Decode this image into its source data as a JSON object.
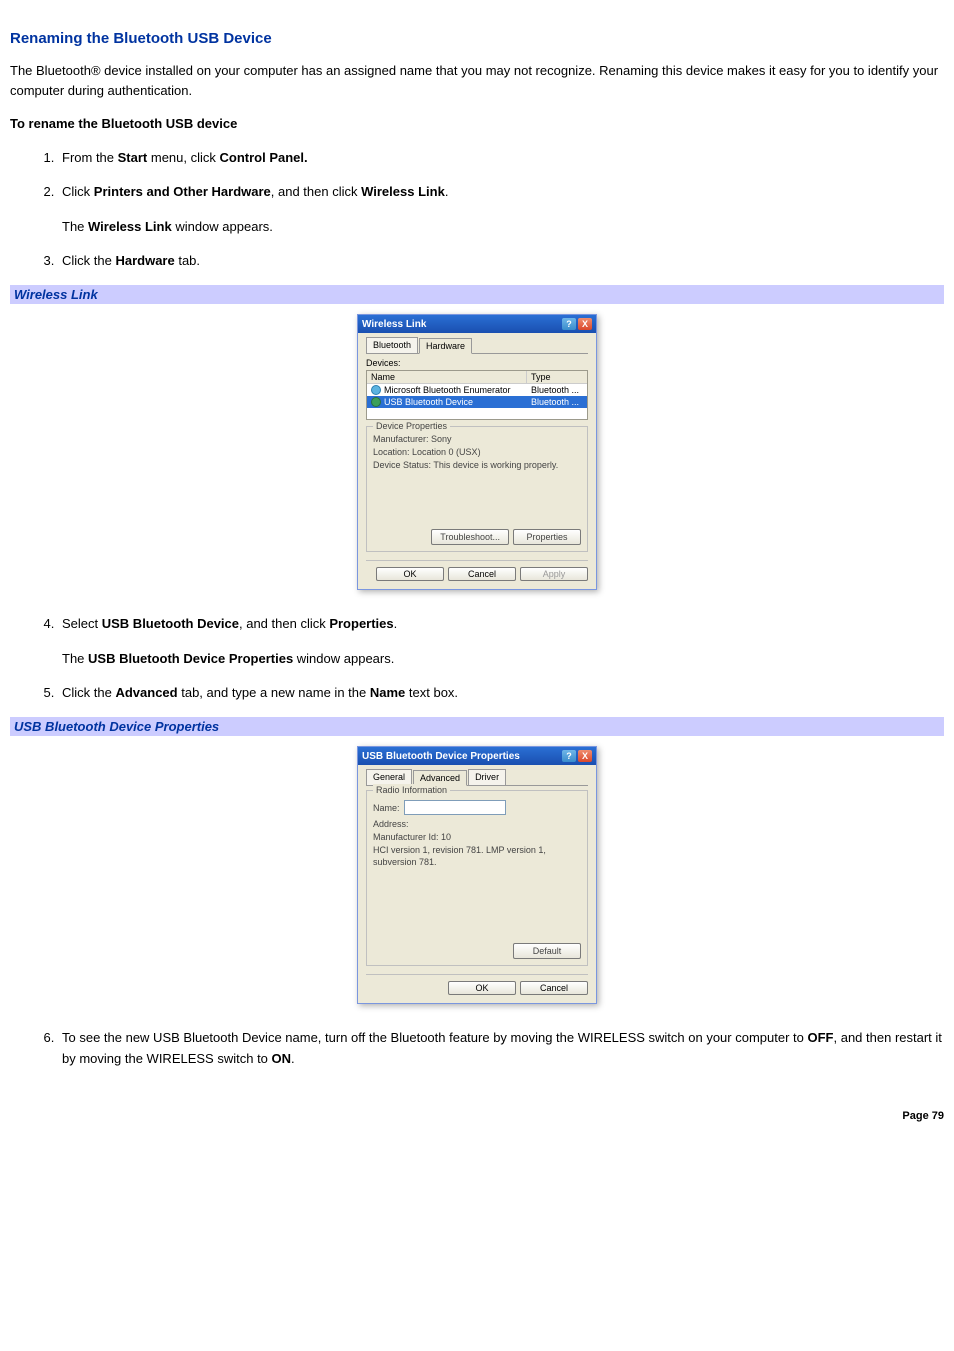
{
  "title": "Renaming the Bluetooth USB Device",
  "intro": "The Bluetooth® device installed on your computer has an assigned name that you may not recognize. Renaming this device makes it easy for you to identify your computer during authentication.",
  "subhead": "To rename the Bluetooth USB device",
  "steps": {
    "s1a": "From the ",
    "s1b": "Start",
    "s1c": " menu, click ",
    "s1d": "Control Panel.",
    "s2a": "Click ",
    "s2b": "Printers and Other Hardware",
    "s2c": ", and then click ",
    "s2d": "Wireless Link",
    "s2e": ".",
    "s2f": "The ",
    "s2g": "Wireless Link",
    "s2h": " window appears.",
    "s3a": "Click the ",
    "s3b": "Hardware",
    "s3c": " tab.",
    "s4a": "Select ",
    "s4b": "USB Bluetooth Device",
    "s4c": ", and then click ",
    "s4d": "Properties",
    "s4e": ".",
    "s4f": "The ",
    "s4g": "USB Bluetooth Device Properties",
    "s4h": " window appears.",
    "s5a": "Click the ",
    "s5b": "Advanced",
    "s5c": " tab, and type a new name in the ",
    "s5d": "Name",
    "s5e": " text box.",
    "s6a": "To see the new USB Bluetooth Device name, turn off the Bluetooth feature by moving the WIRELESS switch on your computer to ",
    "s6b": "OFF",
    "s6c": ", and then restart it by moving the WIRELESS switch to ",
    "s6d": "ON",
    "s6e": "."
  },
  "caption1": "Wireless Link",
  "caption2": "USB Bluetooth Device Properties",
  "dlg1": {
    "title": "Wireless Link",
    "tab_bluetooth": "Bluetooth",
    "tab_hardware": "Hardware",
    "devices_label": "Devices:",
    "col_name": "Name",
    "col_type": "Type",
    "row1_name": "Microsoft Bluetooth Enumerator",
    "row1_type": "Bluetooth ...",
    "row2_name": "USB Bluetooth Device",
    "row2_type": "Bluetooth ...",
    "group_title": "Device Properties",
    "manufacturer": "Manufacturer: Sony",
    "location": "Location: Location 0 (USX)",
    "status": "Device Status: This device is working properly.",
    "btn_troubleshoot": "Troubleshoot...",
    "btn_properties": "Properties",
    "btn_ok": "OK",
    "btn_cancel": "Cancel",
    "btn_apply": "Apply"
  },
  "dlg2": {
    "title": "USB Bluetooth Device Properties",
    "tab_general": "General",
    "tab_advanced": "Advanced",
    "tab_driver": "Driver",
    "group_title": "Radio Information",
    "name_label": "Name:",
    "address_label": "Address:",
    "manufacturer": "Manufacturer Id:    10",
    "hci": "HCI version 1, revision 781.  LMP version 1, subversion 781.",
    "btn_default": "Default",
    "btn_ok": "OK",
    "btn_cancel": "Cancel"
  },
  "page": "Page 79"
}
